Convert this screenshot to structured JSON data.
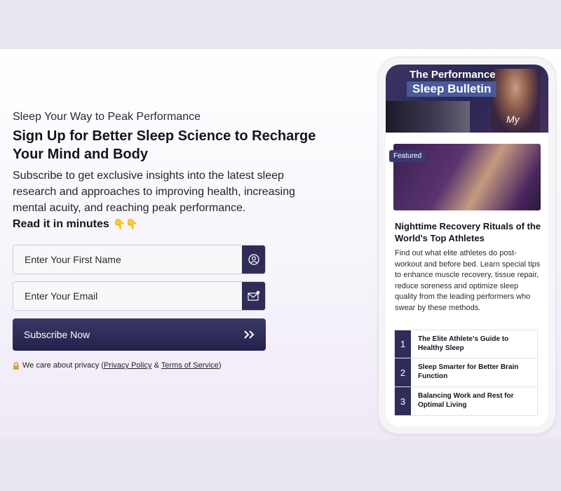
{
  "signup": {
    "kicker": "Sleep Your Way to Peak Performance",
    "headline": "Sign Up for Better Sleep Science to Recharge Your Mind and Body",
    "description": "Subscribe to get exclusive insights into the latest sleep research and approaches to improving health, increasing mental acuity, and reaching peak performance.",
    "read_it": "Read it in minutes",
    "emoji": "👇👇",
    "first_name_placeholder": "Enter Your First Name",
    "email_placeholder": "Enter Your Email",
    "subscribe_label": "Subscribe Now",
    "privacy_prefix": "We care about privacy (",
    "privacy_policy": "Privacy Policy",
    "privacy_and": " & ",
    "terms": "Terms of Service",
    "privacy_suffix": ")"
  },
  "phone": {
    "banner_title_line1": "The Performance",
    "banner_title_line2": "Sleep Bulletin",
    "banner_signature": "My",
    "featured_tag": "Featured",
    "article_title": "Nighttime Recovery Rituals of the World's Top Athletes",
    "article_desc": "Find out what elite athletes do post-workout and before bed. Learn special tips to enhance muscle recovery, tissue repair, reduce soreness and optimize sleep quality from the leading performers who swear by these methods.",
    "list": [
      {
        "num": "1",
        "title": "The Elite Athlete's Guide to Healthy Sleep"
      },
      {
        "num": "2",
        "title": "Sleep Smarter for Better Brain Function"
      },
      {
        "num": "3",
        "title": "Balancing Work and Rest for Optimal Living"
      }
    ]
  },
  "colors": {
    "accent": "#2f2d57",
    "page_background": "#e9e5f1"
  }
}
